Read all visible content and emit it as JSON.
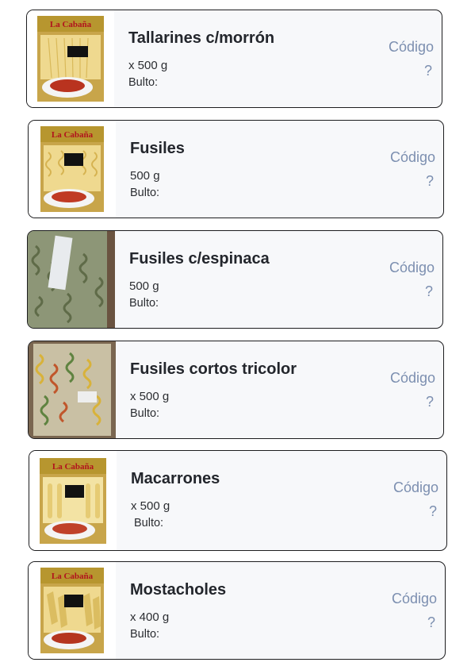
{
  "products": [
    {
      "name": "Tallarines c/morrón",
      "weight": "x 500 g",
      "bulto": "Bulto:",
      "code_label": "Código",
      "code_value": "?",
      "image": "cabana-tallarines-package",
      "brand": "La Cabaña"
    },
    {
      "name": "Fusiles",
      "weight": "500 g",
      "bulto": "Bulto:",
      "code_label": "Código",
      "code_value": "?",
      "image": "cabana-fusiles-package",
      "brand": "La Cabaña"
    },
    {
      "name": "Fusiles c/espinaca",
      "weight": "500 g",
      "bulto": "Bulto:",
      "code_label": "Código",
      "code_value": "?",
      "image": "green-spinach-fusilli-bag"
    },
    {
      "name": "Fusiles cortos tricolor",
      "weight": "x 500 g",
      "bulto": "Bulto:",
      "code_label": "Código",
      "code_value": "?",
      "image": "tricolor-fusilli-bag"
    },
    {
      "name": "Macarrones",
      "weight": "x 500 g",
      "bulto": "Bulto:",
      "code_label": "Código",
      "code_value": "?",
      "image": "cabana-macarrones-package",
      "brand": "La Cabaña"
    },
    {
      "name": "Mostacholes",
      "weight": "x 400 g",
      "bulto": "Bulto:",
      "code_label": "Código",
      "code_value": "?",
      "image": "cabana-mostacholes-package",
      "brand": "La Cabaña"
    }
  ]
}
